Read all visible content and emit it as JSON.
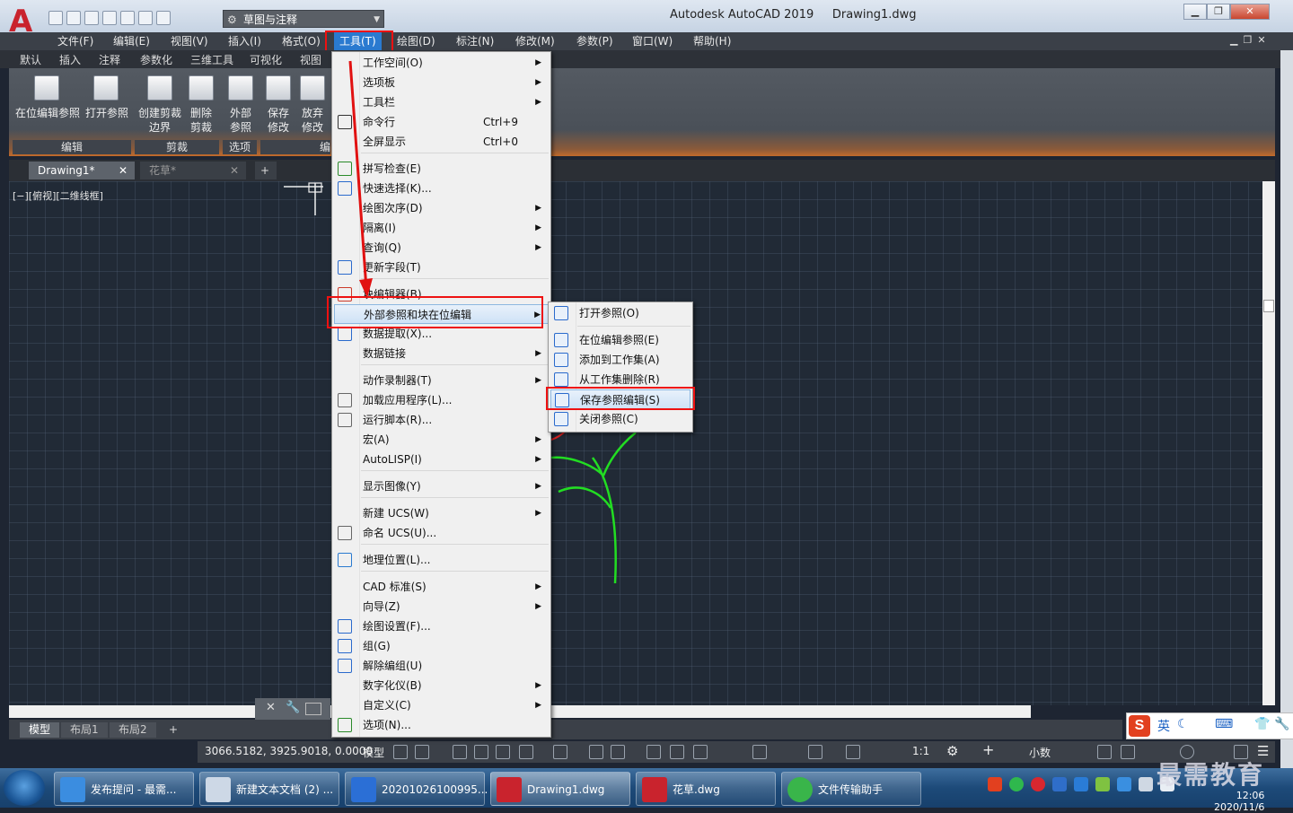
{
  "window": {
    "app_title": "Autodesk AutoCAD 2019",
    "file_title": "Drawing1.dwg",
    "workspace": "草图与注释"
  },
  "menubar": [
    "文件(F)",
    "编辑(E)",
    "视图(V)",
    "插入(I)",
    "格式(O)",
    "工具(T)",
    "绘图(D)",
    "标注(N)",
    "修改(M)",
    "参数(P)",
    "窗口(W)",
    "帮助(H)"
  ],
  "ribbon_tabs": [
    "默认",
    "插入",
    "注释",
    "参数化",
    "三维工具",
    "可视化",
    "视图"
  ],
  "ribbon": {
    "buttons": [
      "在位编辑参照",
      "打开参照",
      "创建剪裁\n边界",
      "删除\n剪裁",
      "外部\n参照",
      "保存\n修改",
      "放弃\n修改"
    ],
    "panels": [
      "编辑",
      "剪裁",
      "选项",
      "编"
    ]
  },
  "file_tabs": [
    "Drawing1*",
    "花草*"
  ],
  "viewport_label": "[−][俯视][二维线框]",
  "tools_menu": [
    {
      "label": "工作空间(O)",
      "arrow": true
    },
    {
      "label": "选项板",
      "arrow": true
    },
    {
      "label": "工具栏",
      "arrow": true
    },
    {
      "label": "命令行",
      "shortcut": "Ctrl+9"
    },
    {
      "label": "全屏显示",
      "shortcut": "Ctrl+0"
    },
    {
      "label": "拼写检查(E)"
    },
    {
      "label": "快速选择(K)..."
    },
    {
      "label": "绘图次序(D)",
      "arrow": true
    },
    {
      "label": "隔离(I)",
      "arrow": true
    },
    {
      "label": "查询(Q)",
      "arrow": true
    },
    {
      "label": "更新字段(T)"
    },
    {
      "label": "块编辑器(B)"
    },
    {
      "label": "外部参照和块在位编辑",
      "arrow": true
    },
    {
      "label": "数据提取(X)..."
    },
    {
      "label": "数据链接",
      "arrow": true
    },
    {
      "label": "动作录制器(T)",
      "arrow": true
    },
    {
      "label": "加载应用程序(L)..."
    },
    {
      "label": "运行脚本(R)..."
    },
    {
      "label": "宏(A)",
      "arrow": true
    },
    {
      "label": "AutoLISP(I)",
      "arrow": true
    },
    {
      "label": "显示图像(Y)",
      "arrow": true
    },
    {
      "label": "新建 UCS(W)",
      "arrow": true
    },
    {
      "label": "命名 UCS(U)..."
    },
    {
      "label": "地理位置(L)..."
    },
    {
      "label": "CAD 标准(S)",
      "arrow": true
    },
    {
      "label": "向导(Z)",
      "arrow": true
    },
    {
      "label": "绘图设置(F)..."
    },
    {
      "label": "组(G)"
    },
    {
      "label": "解除编组(U)"
    },
    {
      "label": "数字化仪(B)",
      "arrow": true
    },
    {
      "label": "自定义(C)",
      "arrow": true
    },
    {
      "label": "选项(N)..."
    }
  ],
  "xref_submenu": [
    "打开参照(O)",
    "在位编辑参照(E)",
    "添加到工作集(A)",
    "从工作集删除(R)",
    "保存参照编辑(S)",
    "关闭参照(C)"
  ],
  "layout_tabs": [
    "模型",
    "布局1",
    "布局2"
  ],
  "status": {
    "coords": "3066.5182, 3925.9018, 0.0000",
    "mode": "模型",
    "scale": "1:1",
    "units": "小数"
  },
  "taskbar": [
    {
      "label": "发布提问 - 最需..."
    },
    {
      "label": "新建文本文档 (2) ..."
    },
    {
      "label": "20201026100995..."
    },
    {
      "label": "Drawing1.dwg"
    },
    {
      "label": "花草.dwg"
    },
    {
      "label": "文件传输助手"
    }
  ],
  "clock": {
    "time": "12:06",
    "date": "2020/11/6"
  },
  "ime": {
    "lang": "英"
  },
  "watermark": "最需教育",
  "colors": {
    "highlight_box": "#e11111",
    "canvas": "#212a36",
    "plant_stroke": "#22dd22"
  }
}
